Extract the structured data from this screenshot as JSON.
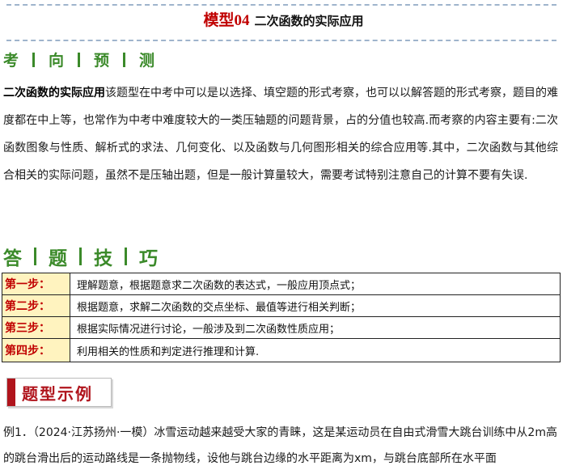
{
  "header": {
    "title_prefix": "模型04",
    "title_rest": "二次函数的实际应用"
  },
  "section_exam_direction": {
    "chars": [
      "考",
      "向",
      "预",
      "测"
    ]
  },
  "intro": {
    "lead": "二次函数的实际应用",
    "body": "该题型在中考中可以是以选择、填空题的形式考察，也可以以解答题的形式考察，题目的难度都在中上等，也常作为中考中难度较大的一类压轴题的问题背景，占的分值也较高.而考察的内容主要有:二次函数图象与性质、解析式的求法、几何变化、以及函数与几何图形相关的综合应用等.其中，二次函数与其他综合相关的实际问题，虽然不是压轴出题，但是一般计算量较大，需要考试特别注意自己的计算不要有失误."
  },
  "section_answer_tips": {
    "chars": [
      "答",
      "题",
      "技",
      "巧"
    ]
  },
  "steps": [
    {
      "label": "第一步：",
      "text": "理解题意，根据题意求二次函数的表达式，一般应用顶点式；"
    },
    {
      "label": "第二步：",
      "text": "根据题意，求解二次函数的交点坐标、最值等进行相关判断；"
    },
    {
      "label": "第三步：",
      "text": "根据实际情况进行讨论，一般涉及到二次函数性质应用；"
    },
    {
      "label": "第四步：",
      "text": "利用相关的性质和判定进行推理和计算."
    }
  ],
  "badge": {
    "label": "题型示例"
  },
  "example": {
    "text": "例1．（2024·江苏扬州·一模）冰雪运动越来越受大家的青睐，这是某运动员在自由式滑雪大跳台训练中从2m高的跳台滑出后的运动路线是一条抛物线，设他与跳台边缘的水平距离为xm，与跳台底部所在水平面"
  },
  "colors": {
    "title_red": "#c00000",
    "section_green": "#3b8a2a",
    "step_label_bg": "#fff3bf",
    "badge_red": "#b0141c",
    "dash_blue": "#9fb4cc"
  }
}
